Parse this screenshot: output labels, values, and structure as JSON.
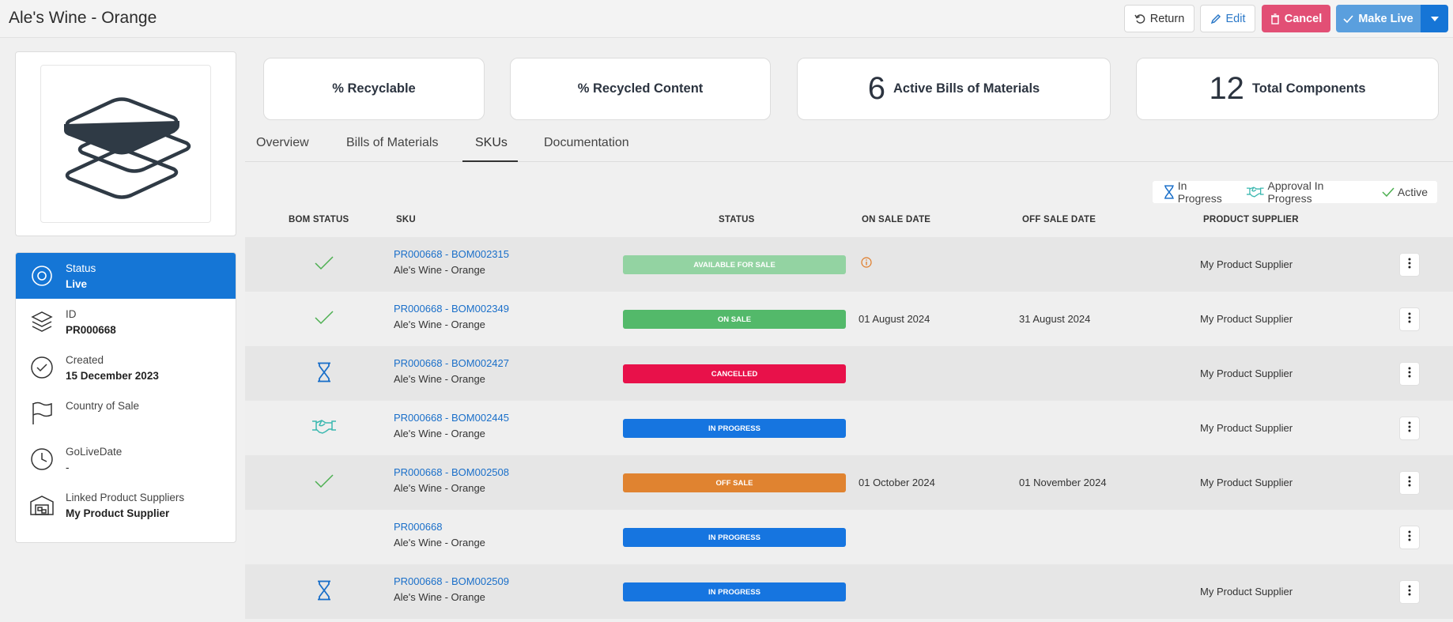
{
  "header": {
    "title": "Ale's Wine - Orange",
    "buttons": {
      "return_label": "Return",
      "edit_label": "Edit",
      "cancel_label": "Cancel",
      "make_live_label": "Make Live"
    }
  },
  "info": {
    "status_label": "Status",
    "status_value": "Live",
    "id_label": "ID",
    "id_value": "PR000668",
    "created_label": "Created",
    "created_value": "15 December 2023",
    "country_label": "Country of Sale",
    "golive_label": "GoLiveDate",
    "golive_value": "-",
    "suppliers_label": "Linked Product Suppliers",
    "suppliers_value": "My Product Supplier"
  },
  "stats": {
    "recyclable_label": "% Recyclable",
    "recycled_content_label": "% Recycled Content",
    "active_boms_count": "6",
    "active_boms_label": "Active Bills of Materials",
    "components_count": "12",
    "components_label": "Total Components"
  },
  "tabs": [
    "Overview",
    "Bills of Materials",
    "SKUs",
    "Documentation"
  ],
  "active_tab": "SKUs",
  "legend": {
    "in_progress": "In Progress",
    "approval_in_progress": "Approval In Progress",
    "active": "Active"
  },
  "table": {
    "headers": {
      "bom_status": "BOM STATUS",
      "sku": "SKU",
      "status": "STATUS",
      "on_sale": "ON SALE DATE",
      "off_sale": "OFF SALE DATE",
      "supplier": "PRODUCT SUPPLIER"
    },
    "rows": [
      {
        "bom_icon": "check-icon",
        "sku_link": "PR000668 - BOM002315",
        "sku_name": "Ale's Wine - Orange",
        "status": "AVAILABLE FOR SALE",
        "status_color": "#93d3a2",
        "on_sale": "",
        "on_sale_icon": "info-icon",
        "off_sale": "",
        "supplier": "My Product Supplier"
      },
      {
        "bom_icon": "check-icon",
        "sku_link": "PR000668 - BOM002349",
        "sku_name": "Ale's Wine - Orange",
        "status": "ON SALE",
        "status_color": "#53b96a",
        "on_sale": "01 August 2024",
        "off_sale": "31 August 2024",
        "supplier": "My Product Supplier"
      },
      {
        "bom_icon": "hourglass-icon",
        "sku_link": "PR000668 - BOM002427",
        "sku_name": "Ale's Wine - Orange",
        "status": "CANCELLED",
        "status_color": "#e8114a",
        "on_sale": "",
        "off_sale": "",
        "supplier": "My Product Supplier"
      },
      {
        "bom_icon": "handshake-icon",
        "sku_link": "PR000668 - BOM002445",
        "sku_name": "Ale's Wine - Orange",
        "status": "IN PROGRESS",
        "status_color": "#1675e0",
        "on_sale": "",
        "off_sale": "",
        "supplier": "My Product Supplier"
      },
      {
        "bom_icon": "check-icon",
        "sku_link": "PR000668 - BOM002508",
        "sku_name": "Ale's Wine - Orange",
        "status": "OFF SALE",
        "status_color": "#e08330",
        "on_sale": "01 October 2024",
        "off_sale": "01 November 2024",
        "supplier": "My Product Supplier"
      },
      {
        "bom_icon": "",
        "sku_link": "PR000668",
        "sku_name": "Ale's Wine - Orange",
        "status": "IN PROGRESS",
        "status_color": "#1675e0",
        "on_sale": "",
        "off_sale": "",
        "supplier": ""
      },
      {
        "bom_icon": "hourglass-icon",
        "sku_link": "PR000668 - BOM002509",
        "sku_name": "Ale's Wine - Orange",
        "status": "IN PROGRESS",
        "status_color": "#1675e0",
        "on_sale": "",
        "off_sale": "",
        "supplier": "My Product Supplier"
      }
    ]
  },
  "colors": {
    "primary": "#1576d6",
    "link": "#1a6fc9",
    "cancel": "#e24f75",
    "check": "#4caf50",
    "handshake": "#3bb8b0"
  }
}
